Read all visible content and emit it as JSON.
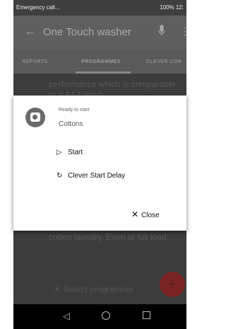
{
  "status_bar": {
    "left": "Emergency call...",
    "right": "100% 12:"
  },
  "app_bar": {
    "back": "←",
    "title": "One Touch washer",
    "more": "⋮"
  },
  "tabs": [
    {
      "label": "REPORTS",
      "active": false
    },
    {
      "label": "PROGRAMMES",
      "active": true
    },
    {
      "label": "CLEVER CON",
      "active": false
    }
  ],
  "background_content": {
    "para1": "performance which is comparable to a AAA wash",
    "para2": "cotton laundry. Even at full load.",
    "select_programme": "Select programme",
    "fab_label": "+"
  },
  "dialog": {
    "status": "Ready to start",
    "programme": "Cottons",
    "start_label": "Start",
    "clever_start_delay_label": "Clever Start Delay",
    "close_label": "Close"
  },
  "nav_bar": {
    "back": "◁"
  },
  "colors": {
    "dim_overlay": "#3a3a3a",
    "dialog_bg": "#ffffff",
    "fab": "#7a2424"
  }
}
